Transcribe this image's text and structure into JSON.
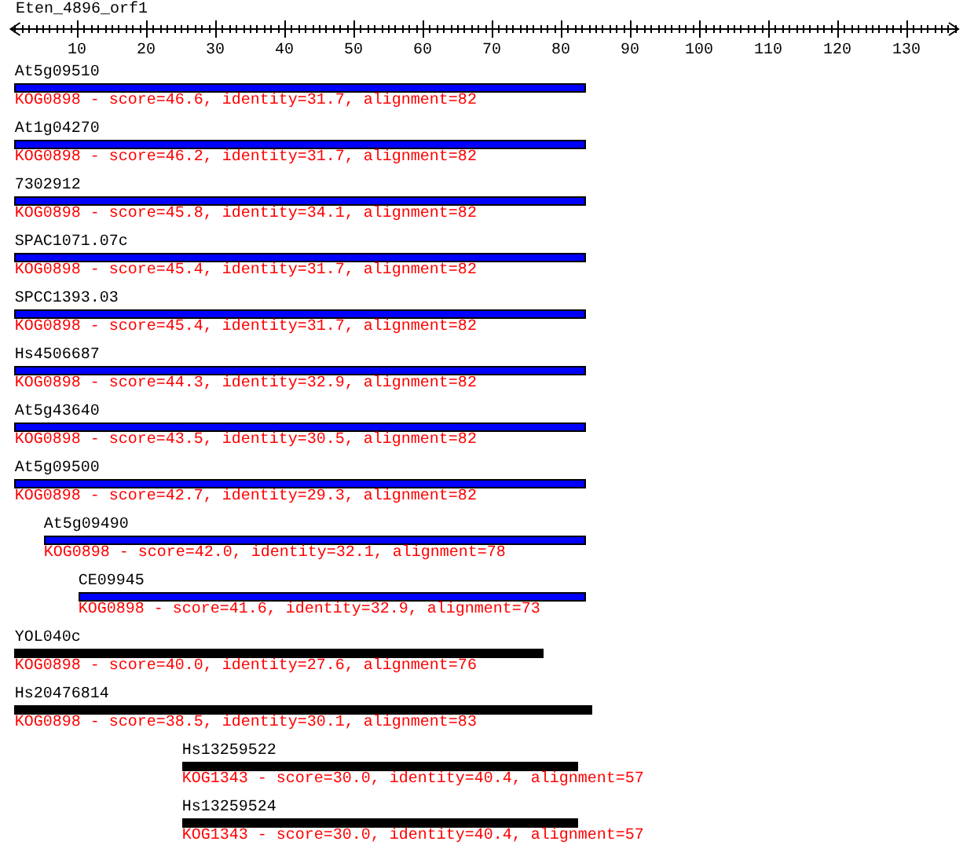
{
  "query": {
    "title": "Eten_4896_orf1"
  },
  "ruler": {
    "ticks": [
      "10",
      "20",
      "30",
      "40",
      "50",
      "60",
      "70",
      "80",
      "90",
      "100",
      "110",
      "120",
      "130"
    ]
  },
  "hits": [
    {
      "name": "At5g09510",
      "description": "KOG0898 - score=46.6, identity=31.7, alignment=82",
      "color": "#0000ff"
    },
    {
      "name": "At1g04270",
      "description": "KOG0898 - score=46.2, identity=31.7, alignment=82",
      "color": "#0000ff"
    },
    {
      "name": "7302912",
      "description": "KOG0898 - score=45.8, identity=34.1, alignment=82",
      "color": "#0000ff"
    },
    {
      "name": "SPAC1071.07c",
      "description": "KOG0898 - score=45.4, identity=31.7, alignment=82",
      "color": "#0000ff"
    },
    {
      "name": "SPCC1393.03",
      "description": "KOG0898 - score=45.4, identity=31.7, alignment=82",
      "color": "#0000ff"
    },
    {
      "name": "Hs4506687",
      "description": "KOG0898 - score=44.3, identity=32.9, alignment=82",
      "color": "#0000ff"
    },
    {
      "name": "At5g43640",
      "description": "KOG0898 - score=43.5, identity=30.5, alignment=82",
      "color": "#0000ff"
    },
    {
      "name": "At5g09500",
      "description": "KOG0898 - score=42.7, identity=29.3, alignment=82",
      "color": "#0000ff"
    },
    {
      "name": "At5g09490",
      "description": "KOG0898 - score=42.0, identity=32.1, alignment=78",
      "color": "#0000ff"
    },
    {
      "name": "CE09945",
      "description": "KOG0898 - score=41.6, identity=32.9, alignment=73",
      "color": "#0000ff"
    },
    {
      "name": "YOL040c",
      "description": "KOG0898 - score=40.0, identity=27.6, alignment=76",
      "color": "#000000"
    },
    {
      "name": "Hs20476814",
      "description": "KOG0898 - score=38.5, identity=30.1, alignment=83",
      "color": "#000000"
    },
    {
      "name": "Hs13259522",
      "description": "KOG1343 - score=30.0, identity=40.4, alignment=57",
      "color": "#000000"
    },
    {
      "name": "Hs13259524",
      "description": "KOG1343 - score=30.0, identity=40.4, alignment=57",
      "color": "#000000"
    }
  ]
}
